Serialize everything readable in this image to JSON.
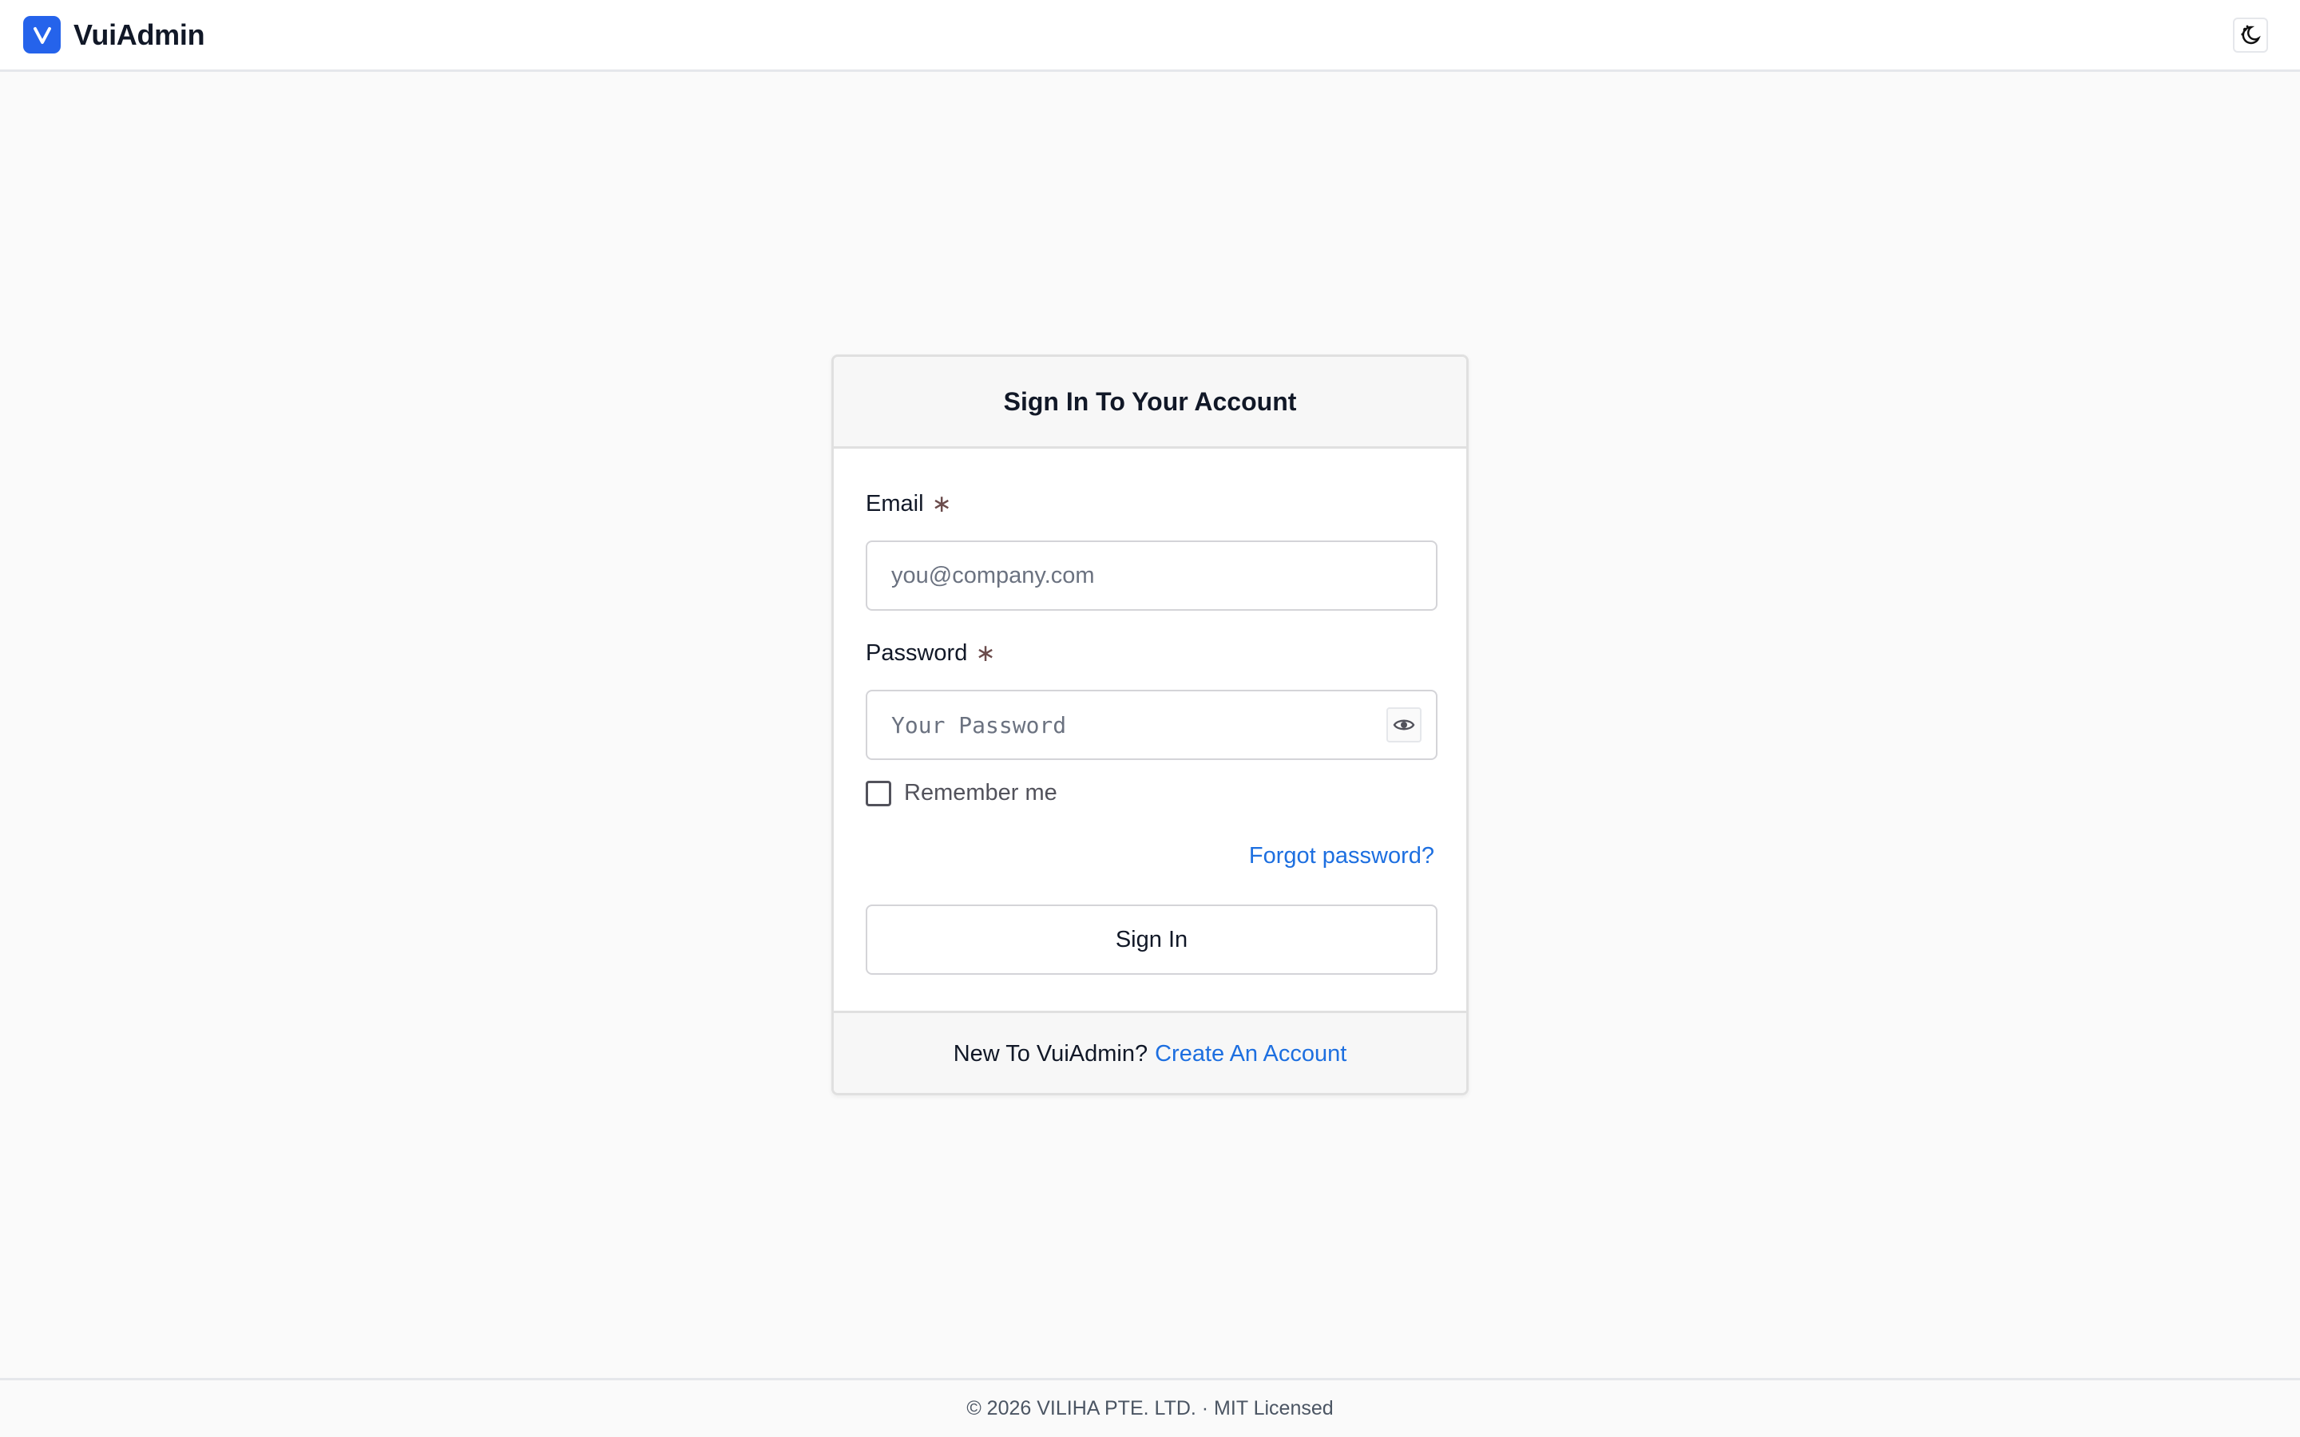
{
  "app": {
    "name": "VuiAdmin"
  },
  "header": {
    "logo_icon": "v-logo-icon",
    "theme_toggle_icon": "moon-sun-icon"
  },
  "login": {
    "title": "Sign In To Your Account",
    "email": {
      "label": "Email",
      "required_mark": "∗",
      "placeholder": "you@company.com",
      "value": ""
    },
    "password": {
      "label": "Password",
      "required_mark": "∗",
      "placeholder": "Your Password",
      "value": "",
      "toggle_icon": "eye-icon"
    },
    "remember_me": {
      "label": "Remember me",
      "checked": false
    },
    "forgot_password": "Forgot password?",
    "submit_label": "Sign In",
    "footer_text": "New To VuiAdmin?",
    "create_account": "Create An Account"
  },
  "footer": {
    "copyright": "© 2026 VILIHA PTE. LTD. · MIT Licensed"
  },
  "colors": {
    "brand": "#2563eb",
    "link": "#1d6fe0",
    "background": "#fafafa"
  }
}
